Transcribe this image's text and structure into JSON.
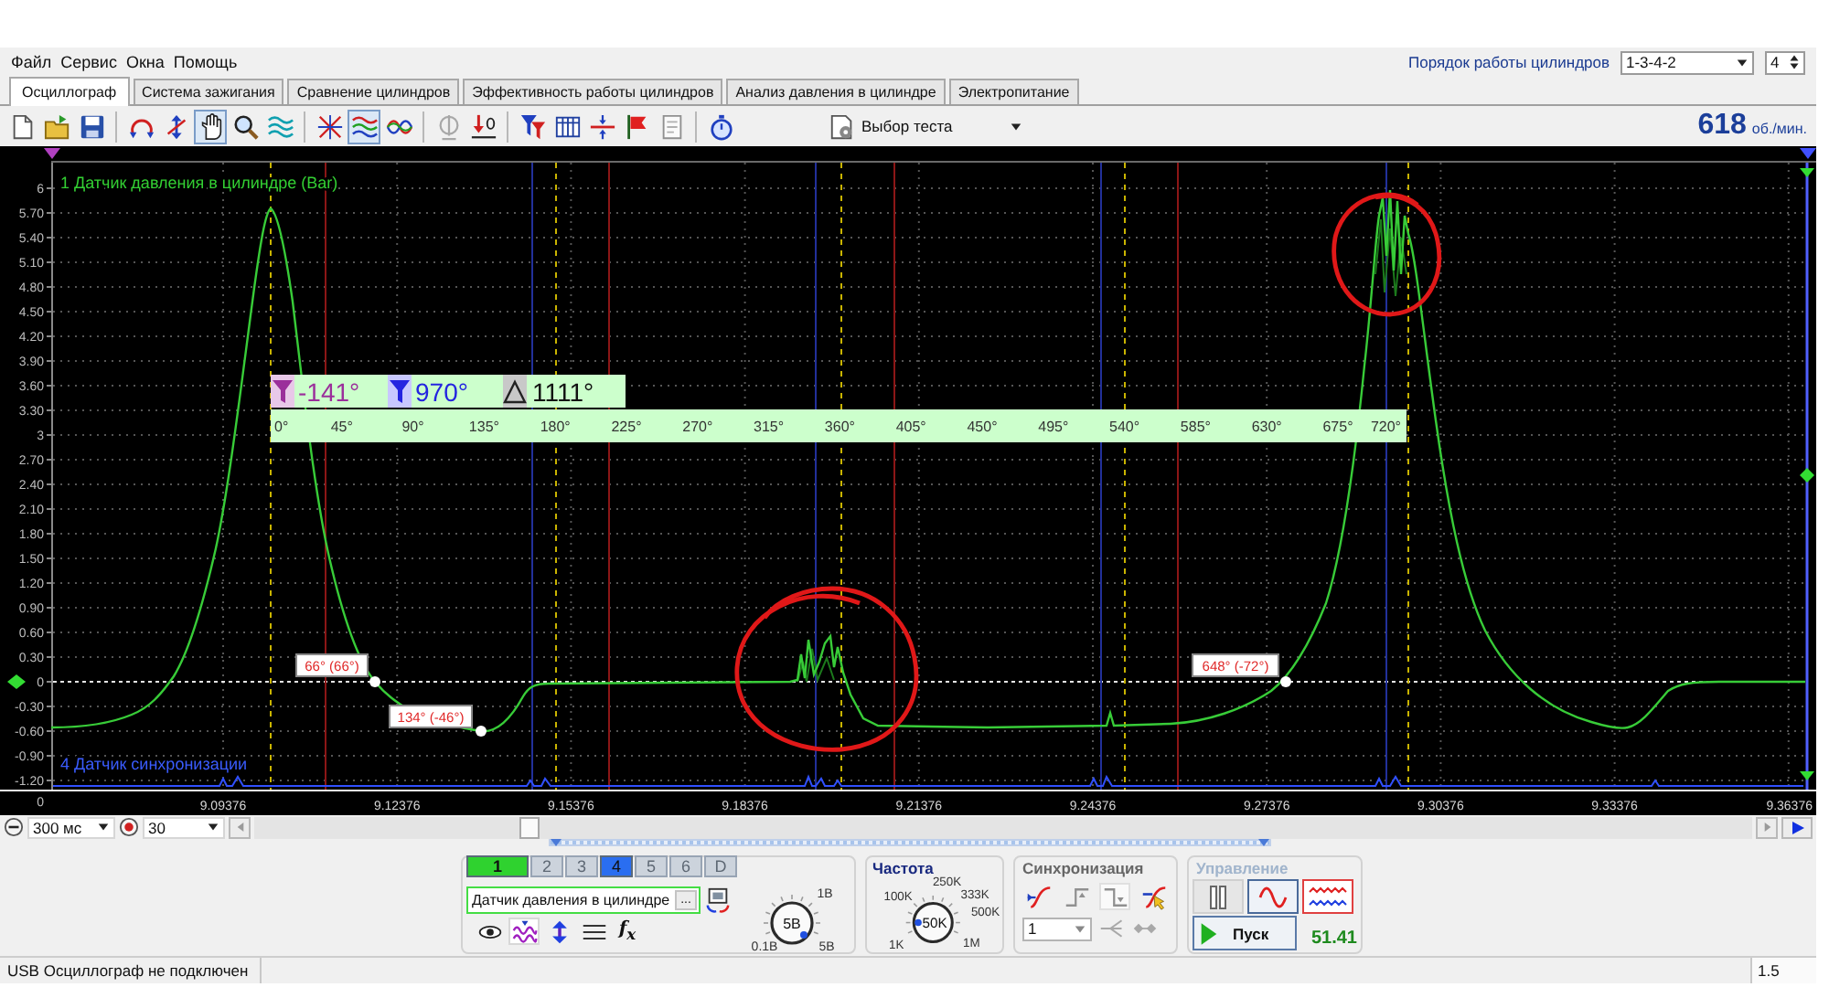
{
  "menu": [
    "Файл",
    "Сервис",
    "Окна",
    "Помощь"
  ],
  "cylinder_order": {
    "label": "Порядок работы цилиндров",
    "value": "1-3-4-2",
    "cylinders": "4"
  },
  "tabs": [
    {
      "label": "Осциллограф",
      "selected": true
    },
    {
      "label": "Система зажигания",
      "selected": false
    },
    {
      "label": "Сравнение цилиндров",
      "selected": false
    },
    {
      "label": "Эффективность работы цилиндров",
      "selected": false
    },
    {
      "label": "Анализ давления в цилиндре",
      "selected": false
    },
    {
      "label": "Электропитание",
      "selected": false
    }
  ],
  "toolbar": {
    "groups": [
      [
        {
          "kind": "new",
          "pressed": false
        },
        {
          "kind": "open",
          "pressed": false
        },
        {
          "kind": "save",
          "pressed": false
        }
      ],
      [
        {
          "kind": "loop",
          "pressed": false
        },
        {
          "kind": "vzoom",
          "pressed": false
        },
        {
          "kind": "hand",
          "pressed": true
        },
        {
          "kind": "magnifier",
          "pressed": false
        },
        {
          "kind": "stack",
          "pressed": false
        }
      ],
      [
        {
          "kind": "crosshair",
          "pressed": false
        },
        {
          "kind": "waves",
          "pressed": true
        },
        {
          "kind": "overlay",
          "pressed": false
        }
      ],
      [
        {
          "kind": "level",
          "pressed": false
        },
        {
          "kind": "zero",
          "pressed": false
        }
      ],
      [
        {
          "kind": "filter",
          "pressed": false
        },
        {
          "kind": "grid",
          "pressed": false
        },
        {
          "kind": "divide",
          "pressed": false
        },
        {
          "kind": "flag",
          "pressed": false
        },
        {
          "kind": "page",
          "pressed": false
        }
      ],
      [
        {
          "kind": "stopwatch",
          "pressed": false
        }
      ]
    ],
    "test_select": "Выбор теста",
    "rpm": "618",
    "rpm_unit": "об./мин."
  },
  "scope": {
    "channel_title": "1 Датчик давления в цилиндре (Bar)",
    "y_labels": [
      "6",
      "5.70",
      "5.40",
      "5.10",
      "4.80",
      "4.50",
      "4.20",
      "3.90",
      "3.60",
      "3.30",
      "3",
      "2.70",
      "2.40",
      "2.10",
      "1.80",
      "1.50",
      "1.20",
      "0.90",
      "0.60",
      "0.30",
      "0",
      "-0.30",
      "-0.60",
      "-0.90",
      "-1.20"
    ],
    "sync_axis_label": "0",
    "sync_title": "4 Датчик синхронизации",
    "time_labels": [
      "9.09376",
      "9.12376",
      "9.15376",
      "9.18376",
      "9.21376",
      "9.24376",
      "9.27376",
      "9.30376",
      "9.33376",
      "9.36376"
    ],
    "cursor_readouts": [
      {
        "kind": "cursor_a",
        "value": "-141°"
      },
      {
        "kind": "cursor_b",
        "value": "970°"
      },
      {
        "kind": "delta",
        "value": "1111°"
      }
    ],
    "angle_labels": [
      "0°",
      "45°",
      "90°",
      "135°",
      "180°",
      "225°",
      "270°",
      "315°",
      "360°",
      "405°",
      "450°",
      "495°",
      "540°",
      "585°",
      "630°",
      "675°",
      "720°"
    ],
    "point_labels": [
      "66° (66°)",
      "134° (-46°)",
      "648° (-72°)"
    ]
  },
  "timeline": {
    "timebase": "300 мс",
    "zoom": "30"
  },
  "channel_panel": {
    "channels": [
      {
        "label": "1",
        "on": true,
        "selected": true,
        "color": "#2fd22f"
      },
      {
        "label": "2",
        "on": false,
        "selected": false
      },
      {
        "label": "3",
        "on": false,
        "selected": false
      },
      {
        "label": "4",
        "on": true,
        "selected": false,
        "color": "#2a6ef0"
      },
      {
        "label": "5",
        "on": false,
        "selected": false
      },
      {
        "label": "6",
        "on": false,
        "selected": false
      },
      {
        "label": "D",
        "on": false,
        "selected": false
      }
    ],
    "sensor": "Датчик давления в цилиндре",
    "more_button": "...",
    "tools": [
      {
        "kind": "visibility",
        "pressed": false
      },
      {
        "kind": "waveform",
        "pressed": true
      },
      {
        "kind": "scale",
        "pressed": false
      },
      {
        "kind": "lines",
        "pressed": false
      }
    ],
    "formula": "f$_{x}$",
    "range_knob": {
      "value": "5B",
      "scale": [
        "1B",
        "0.1B",
        "5B"
      ]
    }
  },
  "frequency": {
    "title": "Частота",
    "value": "50K",
    "scale": [
      "250K",
      "100K",
      "333K",
      "500K",
      "1K",
      "1M"
    ]
  },
  "sync": {
    "title": "Синхронизация",
    "modes": [
      {
        "kind": "rising",
        "selected": false
      },
      {
        "kind": "step_up",
        "selected": false
      },
      {
        "kind": "step_down",
        "selected": true
      },
      {
        "kind": "edge_cursor",
        "selected": false
      }
    ],
    "channel": "1"
  },
  "control": {
    "title": "Управление",
    "modes": [
      {
        "kind": "pause",
        "selected": false
      },
      {
        "kind": "sine",
        "selected": true
      },
      {
        "kind": "dual",
        "selected": true
      }
    ],
    "start": "Пуск",
    "reading": "51.41"
  },
  "status_bar": {
    "message": "USB Осциллограф не подключен",
    "value": "1.5"
  }
}
